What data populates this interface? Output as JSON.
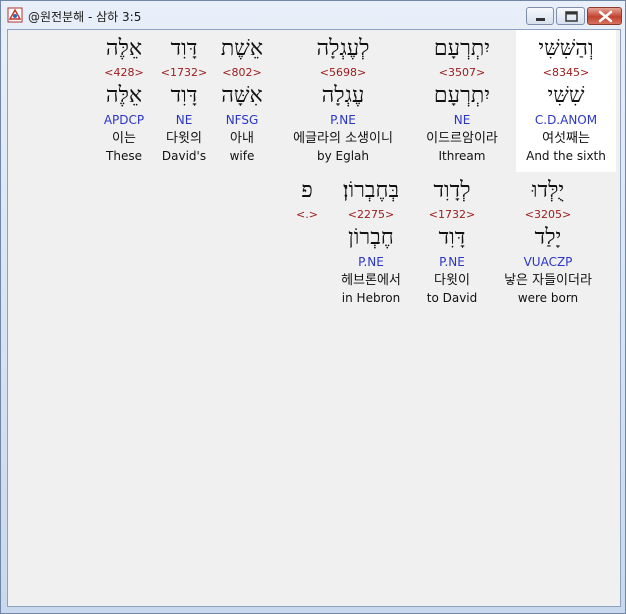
{
  "window": {
    "title": "@원전분해 - 삼하 3:5"
  },
  "row1": [
    {
      "heb": "וְהַשִּׁשִּׁי",
      "strong": "<8345>",
      "lemma": "שִׁשִּׁי",
      "gram": "C.D.ANOM",
      "kor": "여섯째는",
      "eng": "And the sixth",
      "highlight": true
    },
    {
      "heb": "יִתְרְעָם",
      "strong": "<3507>",
      "lemma": "יִתְרְעָם",
      "gram": "NE",
      "kor": "이드르암이라",
      "eng": "Ithream"
    },
    {
      "heb": "לְעֶגְלָה",
      "strong": "<5698>",
      "lemma": "עֶגְלָה",
      "gram": "P.NE",
      "kor": "에글라의 소생이니",
      "eng": "by Eglah"
    },
    {
      "heb": "אֵשֶׁת",
      "strong": "<802>",
      "lemma": "אִשָּׁה",
      "gram": "NFSG",
      "kor": "아내",
      "eng": "wife"
    },
    {
      "heb": "דָּוִד",
      "strong": "<1732>",
      "lemma": "דָּוִד",
      "gram": "NE",
      "kor": "다윗의",
      "eng": "David's"
    },
    {
      "heb": "אֵלֶּה",
      "strong": "<428>",
      "lemma": "אֵלֶּה",
      "gram": "APDCP",
      "kor": "이는",
      "eng": "These"
    }
  ],
  "row2": [
    {
      "heb": "יֻלְּדוּ",
      "strong": "<3205>",
      "lemma": "יָלַד",
      "gram": "VUACZP",
      "kor": "낳은 자들이더라",
      "eng": "were born"
    },
    {
      "heb": "לְדָוִד",
      "strong": "<1732>",
      "lemma": "דָּוִד",
      "gram": "P.NE",
      "kor": "다윗이",
      "eng": "to David"
    },
    {
      "heb": "בְּחֶבְרוֹן׃",
      "strong": "<2275>",
      "lemma": "חֶבְרוֹן",
      "gram": "P.NE",
      "kor": "헤브론에서",
      "eng": "in Hebron"
    },
    {
      "heb": "פ",
      "strong": "<.>",
      "lemma": "",
      "gram": "",
      "kor": "",
      "eng": ""
    }
  ]
}
